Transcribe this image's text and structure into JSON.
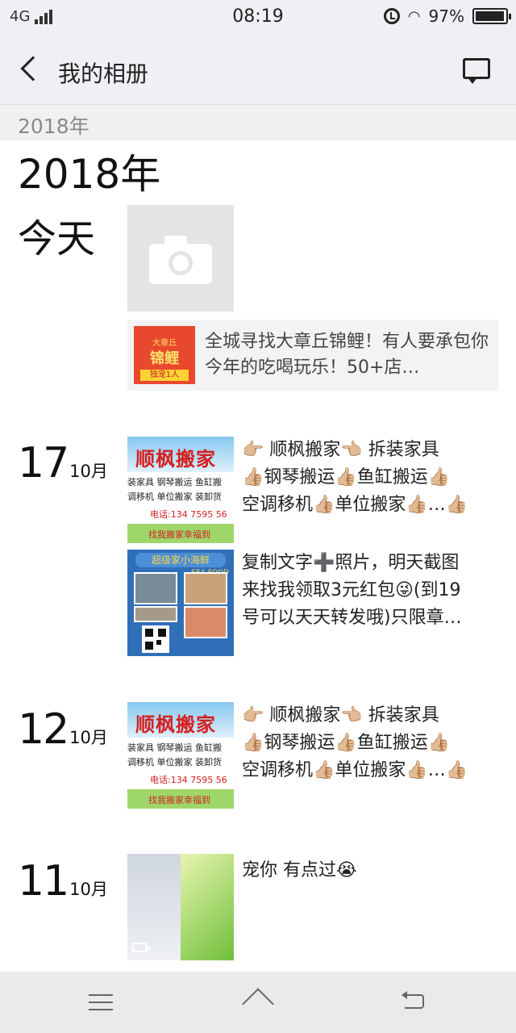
{
  "status_bar": {
    "network": "4G",
    "time": "08:19",
    "battery": "97%"
  },
  "nav": {
    "title": "我的相册"
  },
  "section_header": "2018年",
  "year_title": "2018年",
  "today": {
    "label": "今天",
    "share": {
      "thumb_top": "大章丘",
      "thumb_main": "锦鲤",
      "thumb_badge": "独宠1人",
      "text": "全城寻找大章丘锦鲤！有人要承包你今年的吃喝玩乐！50+店…"
    }
  },
  "entries": [
    {
      "day": "17",
      "month": "10月",
      "posts": [
        {
          "lines": [
            "👉🏼 顺枫搬家👈🏼  拆装家具",
            "👍🏼钢琴搬运👍🏼鱼缸搬运👍🏼",
            "空调移机👍🏼单位搬家👍🏼…👍🏼"
          ],
          "thumb": {
            "title": "顺枫搬家",
            "row1": "装家具  钢琴搬运  鱼缸搬",
            "row2": "调移机  单位搬家  装卸货",
            "phone": "电话:134 7595 56",
            "slogan": "找我搬家幸福到"
          }
        },
        {
          "lines": [
            "复制文字➕照片，明天截图",
            "来找我领取3元红包😜(到19",
            "号可以天天转发哦)只限章…"
          ],
          "thumb": {
            "banner": "超级家小海鲜",
            "tag": "SEA FOOD"
          }
        }
      ]
    },
    {
      "day": "12",
      "month": "10月",
      "posts": [
        {
          "lines": [
            "👉🏼 顺枫搬家👈🏼  拆装家具",
            "👍🏼钢琴搬运👍🏼鱼缸搬运👍🏼",
            "空调移机👍🏼单位搬家👍🏼…👍🏼"
          ],
          "thumb": {
            "title": "顺枫搬家",
            "row1": "装家具  钢琴搬运  鱼缸搬",
            "row2": "调移机  单位搬家  装卸货",
            "phone": "电话:134 7595 56",
            "slogan": "找我搬家幸福到"
          }
        }
      ]
    },
    {
      "day": "11",
      "month": "10月",
      "posts": [
        {
          "lines": [
            "宠你  有点过😭"
          ],
          "thumb": {
            "type": "video"
          }
        }
      ]
    }
  ],
  "icons": {
    "back": "back-chevron-icon",
    "message": "message-icon",
    "camera": "camera-icon",
    "menu": "menu-icon",
    "home": "home-icon",
    "system_back": "system-back-icon"
  }
}
